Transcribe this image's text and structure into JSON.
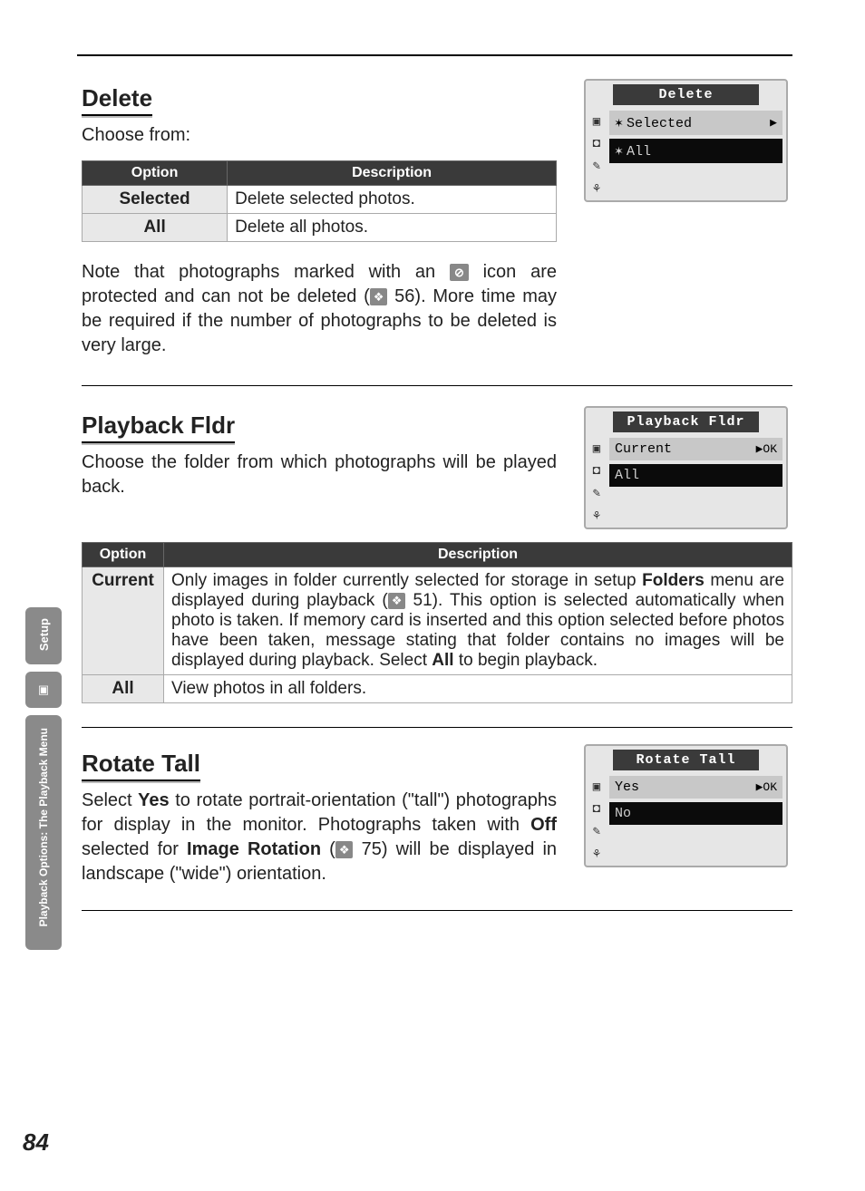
{
  "page_number": "84",
  "side_tabs": {
    "setup_label": "Setup",
    "playback_glyph": "▣",
    "breadcrumb_label": "Playback Options: The Playback Menu"
  },
  "delete": {
    "heading": "Delete",
    "intro": "Choose from:",
    "table": {
      "header_option": "Option",
      "header_desc": "Description",
      "rows": [
        {
          "opt": "Selected",
          "desc": "Delete selected photos."
        },
        {
          "opt": "All",
          "desc": "Delete all photos."
        }
      ]
    },
    "note_parts": {
      "a": "Note that photographs marked with an ",
      "icon": "⊘",
      "b": " icon are protected and can not be deleted (",
      "ref_icon": "❖",
      "c": " 56). More time may be required if the number of photographs to be deleted is very large."
    },
    "lcd": {
      "title": "Delete",
      "side": [
        "▣",
        "◘",
        "✎",
        "⚘"
      ],
      "items": [
        {
          "pre": "✶",
          "label": "Selected",
          "selected": true,
          "arrow": "▶"
        },
        {
          "pre": "✶",
          "label": "All",
          "selected": false,
          "arrow": ""
        }
      ]
    }
  },
  "playback_fldr": {
    "heading": "Playback Fldr",
    "intro": "Choose the folder from which photographs will be played back.",
    "lcd": {
      "title": "Playback Fldr",
      "side": [
        "▣",
        "◘",
        "✎",
        "⚘"
      ],
      "items": [
        {
          "label": "Current",
          "selected": true,
          "arrow": "▶OK"
        },
        {
          "label": "All",
          "selected": false,
          "arrow": ""
        }
      ]
    },
    "table": {
      "header_option": "Option",
      "header_desc": "Description",
      "rows": [
        {
          "opt": "Current",
          "desc_parts": {
            "a": "Only images in folder currently selected for storage in setup ",
            "b": "Folders",
            "c": " menu are displayed during playback (",
            "ref_icon": "❖",
            "d": " 51). This option is selected automatically when photo is taken. If memory card is inserted and this option selected before photos have been taken, message stating that folder contains no images will be displayed during playback. Select ",
            "e": "All",
            "f": " to begin playback."
          }
        },
        {
          "opt": "All",
          "desc": "View photos in all folders."
        }
      ]
    }
  },
  "rotate_tall": {
    "heading": "Rotate Tall",
    "intro_parts": {
      "a": "Select ",
      "b": "Yes",
      "c": " to rotate portrait-orientation (\"tall\") photographs for display in the monitor. Photographs taken with ",
      "d": "Off",
      "e": " selected for ",
      "f": "Image Rotation",
      "g": " (",
      "ref_icon": "❖",
      "h": " 75) will be displayed in landscape (\"wide\") orientation."
    },
    "lcd": {
      "title": "Rotate Tall",
      "side": [
        "▣",
        "◘",
        "✎",
        "⚘"
      ],
      "items": [
        {
          "label": "Yes",
          "selected": true,
          "arrow": "▶OK"
        },
        {
          "label": "No",
          "selected": false,
          "arrow": ""
        }
      ]
    }
  }
}
